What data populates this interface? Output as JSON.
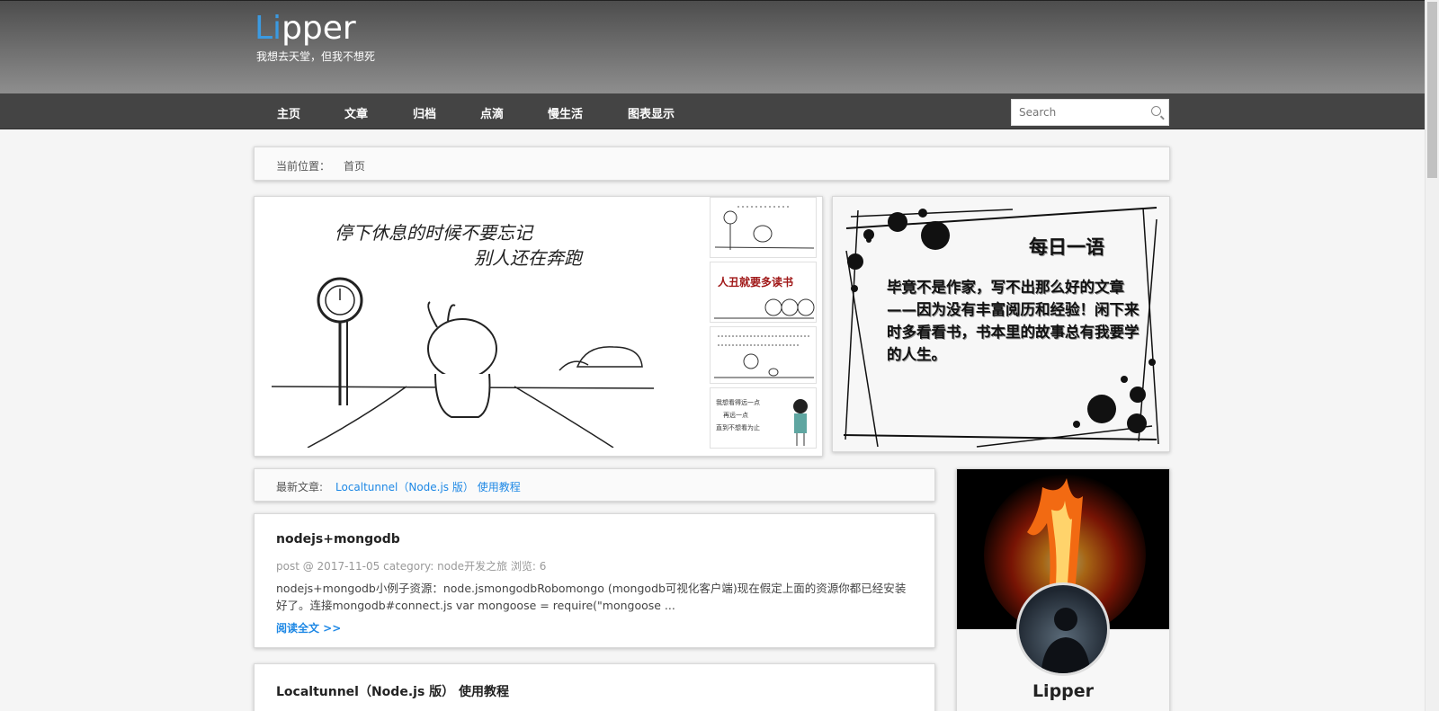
{
  "header": {
    "logo_accent": "Li",
    "logo_rest": "pper",
    "tagline": "我想去天堂，但我不想死"
  },
  "nav": {
    "items": [
      "主页",
      "文章",
      "归档",
      "点滴",
      "慢生活",
      "图表显示"
    ],
    "search_placeholder": "Search"
  },
  "breadcrumb": {
    "label": "当前位置：",
    "current": "首页"
  },
  "slider": {
    "main_caption_line1": "停下休息的时候不要忘记",
    "main_caption_line2": "别人还在奔跑",
    "thumb2_text": "人丑就要多读书",
    "thumb4_line1": "我想看得远一点",
    "thumb4_line2": "再远一点",
    "thumb4_line3": "直到不想看为止"
  },
  "daily_quote": {
    "title": "每日一语",
    "text": "毕竟不是作家，写不出那么好的文章——因为没有丰富阅历和经验！闲下来时多看看书，书本里的故事总有我要学的人生。"
  },
  "latest": {
    "label": "最新文章:",
    "link": "Localtunnel（Node.js 版） 使用教程"
  },
  "posts": [
    {
      "title": "nodejs+mongodb",
      "meta": "post @ 2017-11-05   category: node开发之旅   浏览: 6",
      "excerpt": "nodejs+mongodb小例子资源：node.jsmongodbRobomongo (mongodb可视化客户端)现在假定上面的资源你都已经安装好了。连接mongodb#connect.js var mongoose = require(\"mongoose ...",
      "read_more": "阅读全文 >>"
    },
    {
      "title": "Localtunnel（Node.js 版） 使用教程"
    }
  ],
  "profile": {
    "name": "Lipper"
  },
  "colors": {
    "accent": "#3b9ae1",
    "link": "#1e88e5",
    "nav_bg": "#444444"
  }
}
